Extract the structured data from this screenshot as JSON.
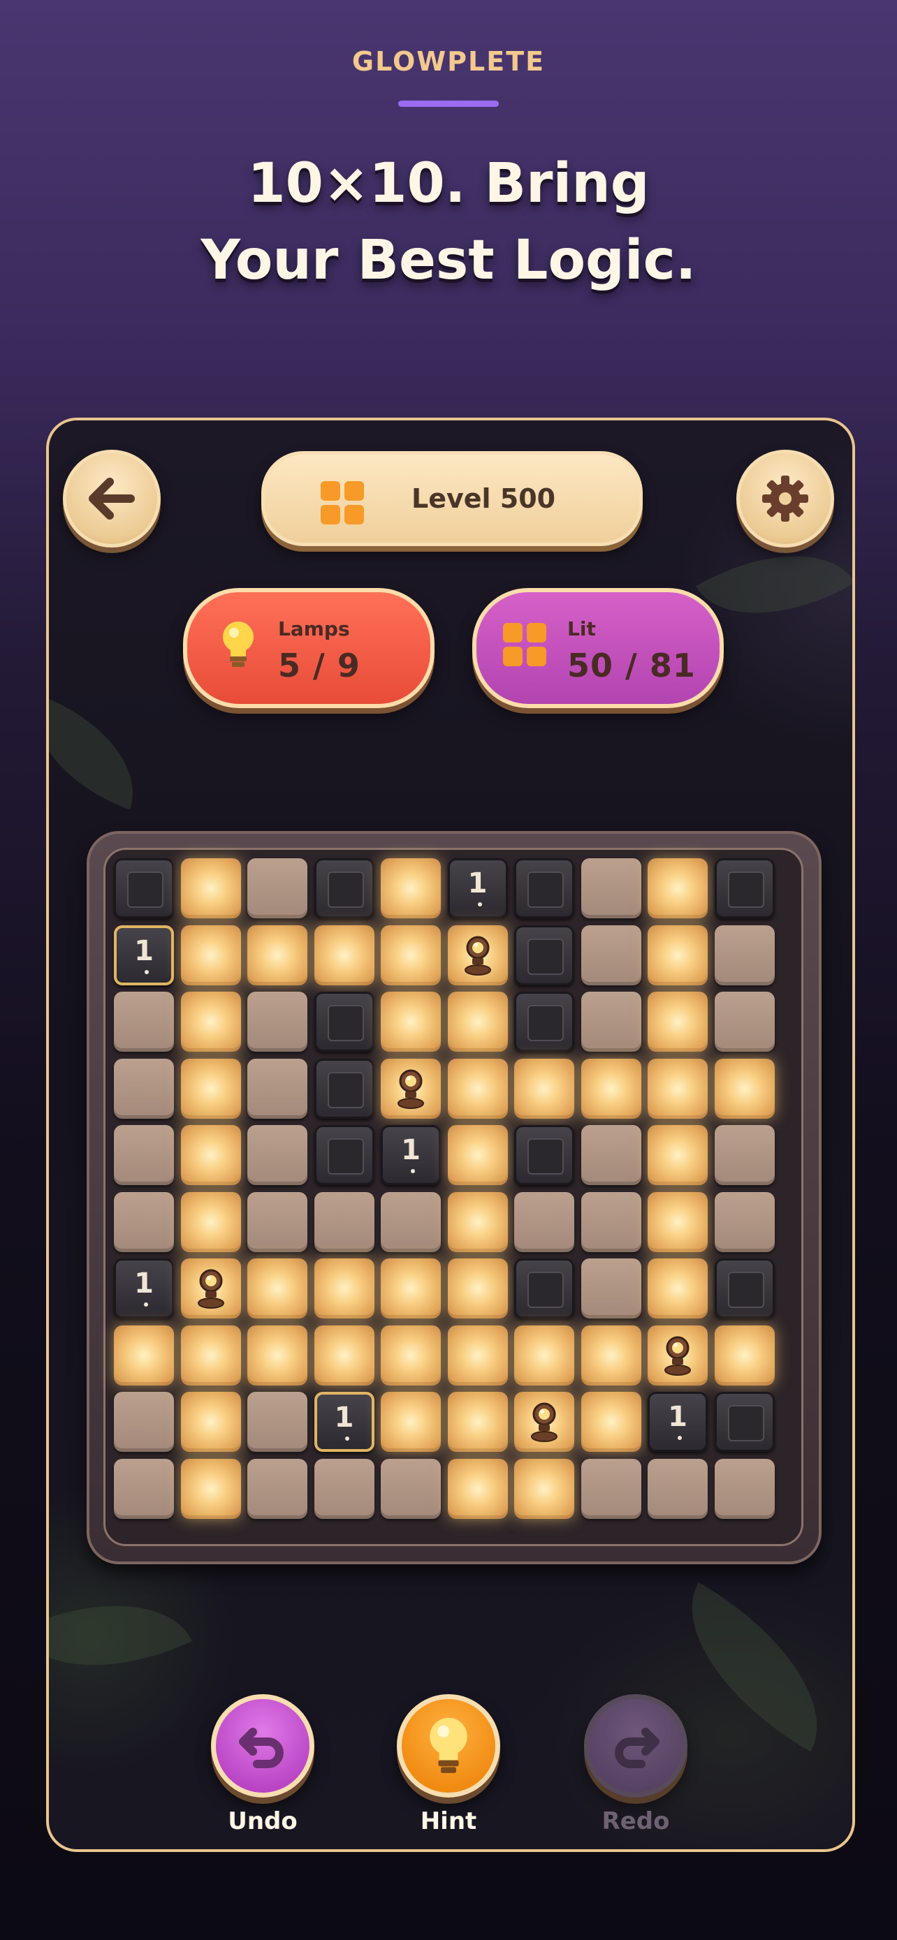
{
  "header": {
    "brand": "GLOWPLETE",
    "headline_line1": "10×10. Bring",
    "headline_line2": "Your Best Logic."
  },
  "top_bar": {
    "back_icon": "arrow-left-icon",
    "level_label": "Level 500",
    "settings_icon": "gear-icon"
  },
  "stats": {
    "lamps": {
      "label": "Lamps",
      "value": "5 / 9",
      "icon": "lightbulb-icon",
      "color": "#ea4f3a"
    },
    "lit": {
      "label": "Lit",
      "value": "50 / 81",
      "icon": "grid-icon",
      "color": "#b446b2"
    }
  },
  "board": {
    "size": 10,
    "legend": {
      "B": "black",
      "1": "black-with-clue-1",
      "W": "unlit",
      "L": "lit",
      "X": "lamp"
    },
    "rows": [
      [
        "B",
        "L",
        "W",
        "B",
        "L",
        "1",
        "B",
        "W",
        "L",
        "B"
      ],
      [
        "1",
        "L",
        "L",
        "L",
        "L",
        "X",
        "B",
        "W",
        "L",
        "W"
      ],
      [
        "W",
        "L",
        "W",
        "B",
        "L",
        "L",
        "B",
        "W",
        "L",
        "W"
      ],
      [
        "W",
        "L",
        "W",
        "B",
        "X",
        "L",
        "L",
        "L",
        "L",
        "L"
      ],
      [
        "W",
        "L",
        "W",
        "B",
        "1",
        "L",
        "B",
        "W",
        "L",
        "W"
      ],
      [
        "W",
        "L",
        "W",
        "W",
        "W",
        "L",
        "W",
        "W",
        "L",
        "W"
      ],
      [
        "1",
        "X",
        "L",
        "L",
        "L",
        "L",
        "B",
        "W",
        "L",
        "B"
      ],
      [
        "L",
        "L",
        "L",
        "L",
        "L",
        "L",
        "L",
        "L",
        "X",
        "L"
      ],
      [
        "W",
        "L",
        "W",
        "1",
        "L",
        "L",
        "X",
        "L",
        "1",
        "B"
      ],
      [
        "W",
        "L",
        "W",
        "W",
        "W",
        "L",
        "L",
        "W",
        "W",
        "W"
      ]
    ],
    "highlighted": [
      "1-0",
      "8-3"
    ]
  },
  "controls": {
    "undo": {
      "label": "Undo",
      "icon": "undo-arrow-icon",
      "color": "#c24ece"
    },
    "hint": {
      "label": "Hint",
      "icon": "lightbulb-icon",
      "color": "#f58e15"
    },
    "redo": {
      "label": "Redo",
      "icon": "redo-arrow-icon",
      "color": "#725a80",
      "disabled": true
    }
  },
  "colors": {
    "accent_purple": "#9a6cf0",
    "brand_gold": "#f3c98e",
    "cream": "#f4d8a8"
  }
}
